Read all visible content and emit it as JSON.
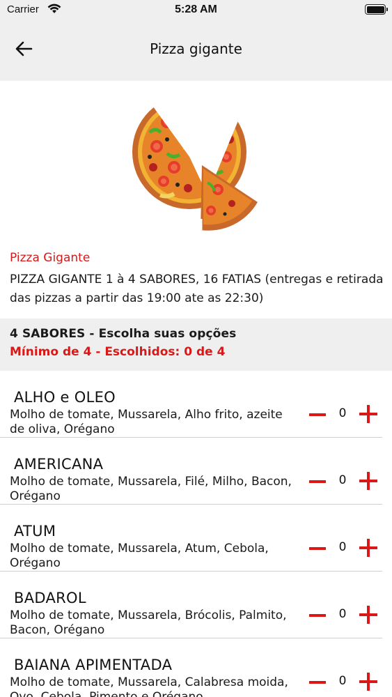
{
  "status_bar": {
    "carrier": "Carrier",
    "time": "5:28 AM"
  },
  "nav": {
    "title": "Pizza gigante",
    "back_icon": "arrow-left-icon"
  },
  "product": {
    "image_icon": "pizza-image",
    "name": "Pizza Gigante",
    "description": "PIZZA GIGANTE 1 à 4 SABORES, 16 FATIAS (entregas e retirada das pizzas a partir das 19:00 ate as 22:30)"
  },
  "group": {
    "title": "4 SABORES - Escolha suas opções",
    "rule": "Mínimo de 4 - Escolhidos: 0 de 4"
  },
  "options": [
    {
      "name": "ALHO e OLEO",
      "description": "Molho de tomate, Mussarela, Alho frito, azeite de oliva, Orégano",
      "qty": "0"
    },
    {
      "name": "AMERICANA",
      "description": "Molho de tomate, Mussarela, Filé, Milho, Bacon, Orégano",
      "qty": "0"
    },
    {
      "name": "ATUM",
      "description": "Molho de tomate, Mussarela, Atum, Cebola, Orégano",
      "qty": "0"
    },
    {
      "name": "BADAROL",
      "description": "Molho de tomate, Mussarela, Brócolis, Palmito, Bacon, Orégano",
      "qty": "0"
    },
    {
      "name": "BAIANA APIMENTADA",
      "description": "Molho de tomate, Mussarela, Calabresa moida, Ovo, Cebola, Pimento e Orégano",
      "qty": "0"
    }
  ],
  "colors": {
    "accent": "#d91818",
    "header_bg": "#efefef",
    "divider": "#cfcfcf"
  }
}
